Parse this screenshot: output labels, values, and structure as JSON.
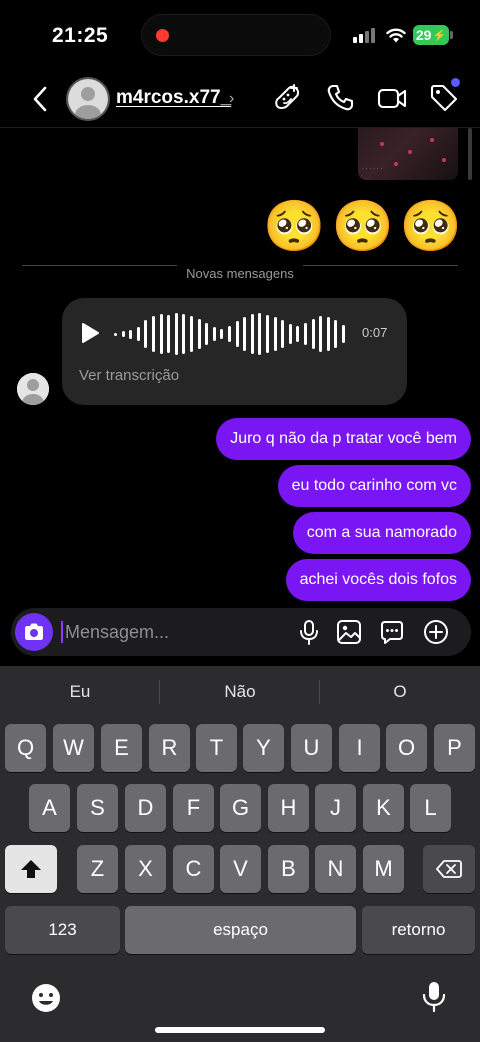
{
  "status_bar": {
    "time": "21:25",
    "battery": "29"
  },
  "header": {
    "username": "m4rcos.x77_"
  },
  "chat": {
    "emojis": "🥺🥺🥺",
    "divider_label": "Novas mensagens",
    "voice_message": {
      "duration": "0:07",
      "transcript_link": "Ver transcrição"
    },
    "sent_messages": [
      "Juro q não da p tratar você bem",
      "eu todo carinho com vc",
      "com a sua namorado",
      "achei vocês dois fofos"
    ]
  },
  "composer": {
    "placeholder": "Mensagem..."
  },
  "keyboard": {
    "suggestions": [
      "Eu",
      "Não",
      "O"
    ],
    "row1": [
      "Q",
      "W",
      "E",
      "R",
      "T",
      "Y",
      "U",
      "I",
      "O",
      "P"
    ],
    "row2": [
      "A",
      "S",
      "D",
      "F",
      "G",
      "H",
      "J",
      "K",
      "L"
    ],
    "row3": [
      "Z",
      "X",
      "C",
      "V",
      "B",
      "N",
      "M"
    ],
    "numbers_key": "123",
    "space_key": "espaço",
    "return_key": "retorno"
  },
  "colors": {
    "sent_bubble": "#7a16f3",
    "received_bubble": "#262626",
    "camera_button": "#6f33f5"
  }
}
